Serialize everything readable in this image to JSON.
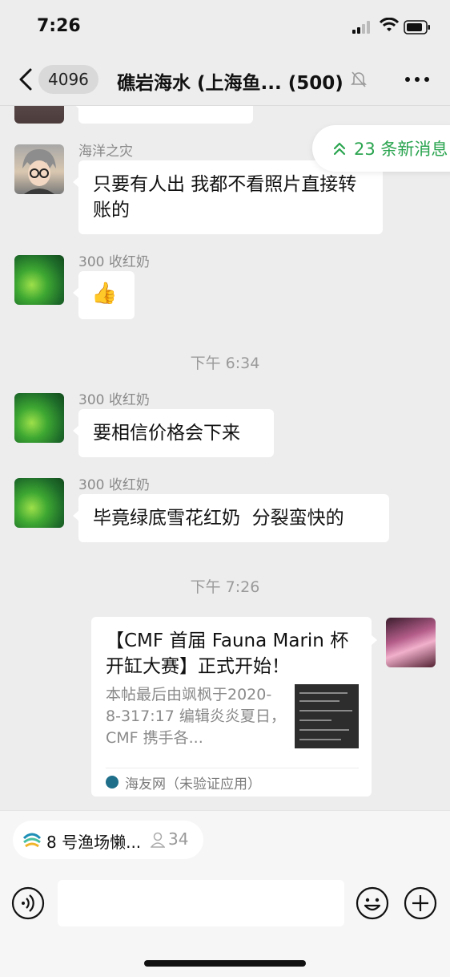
{
  "status_bar": {
    "time": "7:26"
  },
  "header": {
    "unread_count": "4096",
    "title": "礁岩海水 (上海鱼... (500)"
  },
  "new_messages": {
    "label": "23 条新消息"
  },
  "messages": [
    {
      "sender": "海洋之灾",
      "text": "只要有人出 我都不看照片直接转账的"
    },
    {
      "sender": "300 收红奶",
      "text": "👍"
    },
    {
      "sender": "300 收红奶",
      "text": "要相信价格会下来"
    },
    {
      "sender": "300 收红奶",
      "text": "毕竟绿底雪花红奶  分裂蛮快的"
    }
  ],
  "time_dividers": [
    "下午 6:34",
    "下午 7:26"
  ],
  "link_card": {
    "title": "【CMF 首届 Fauna Marin 杯开缸大赛】正式开始！",
    "description": "本帖最后由飒枫于2020-8-317:17 编辑炎炎夏日，CMF 携手各...",
    "source": "海友网（未验证应用）"
  },
  "mini_app": {
    "label": "8 号渔场懒...",
    "count": "34"
  },
  "colors": {
    "accent_green": "#2aa44f",
    "background": "#ededed",
    "bubble": "#ffffff"
  }
}
